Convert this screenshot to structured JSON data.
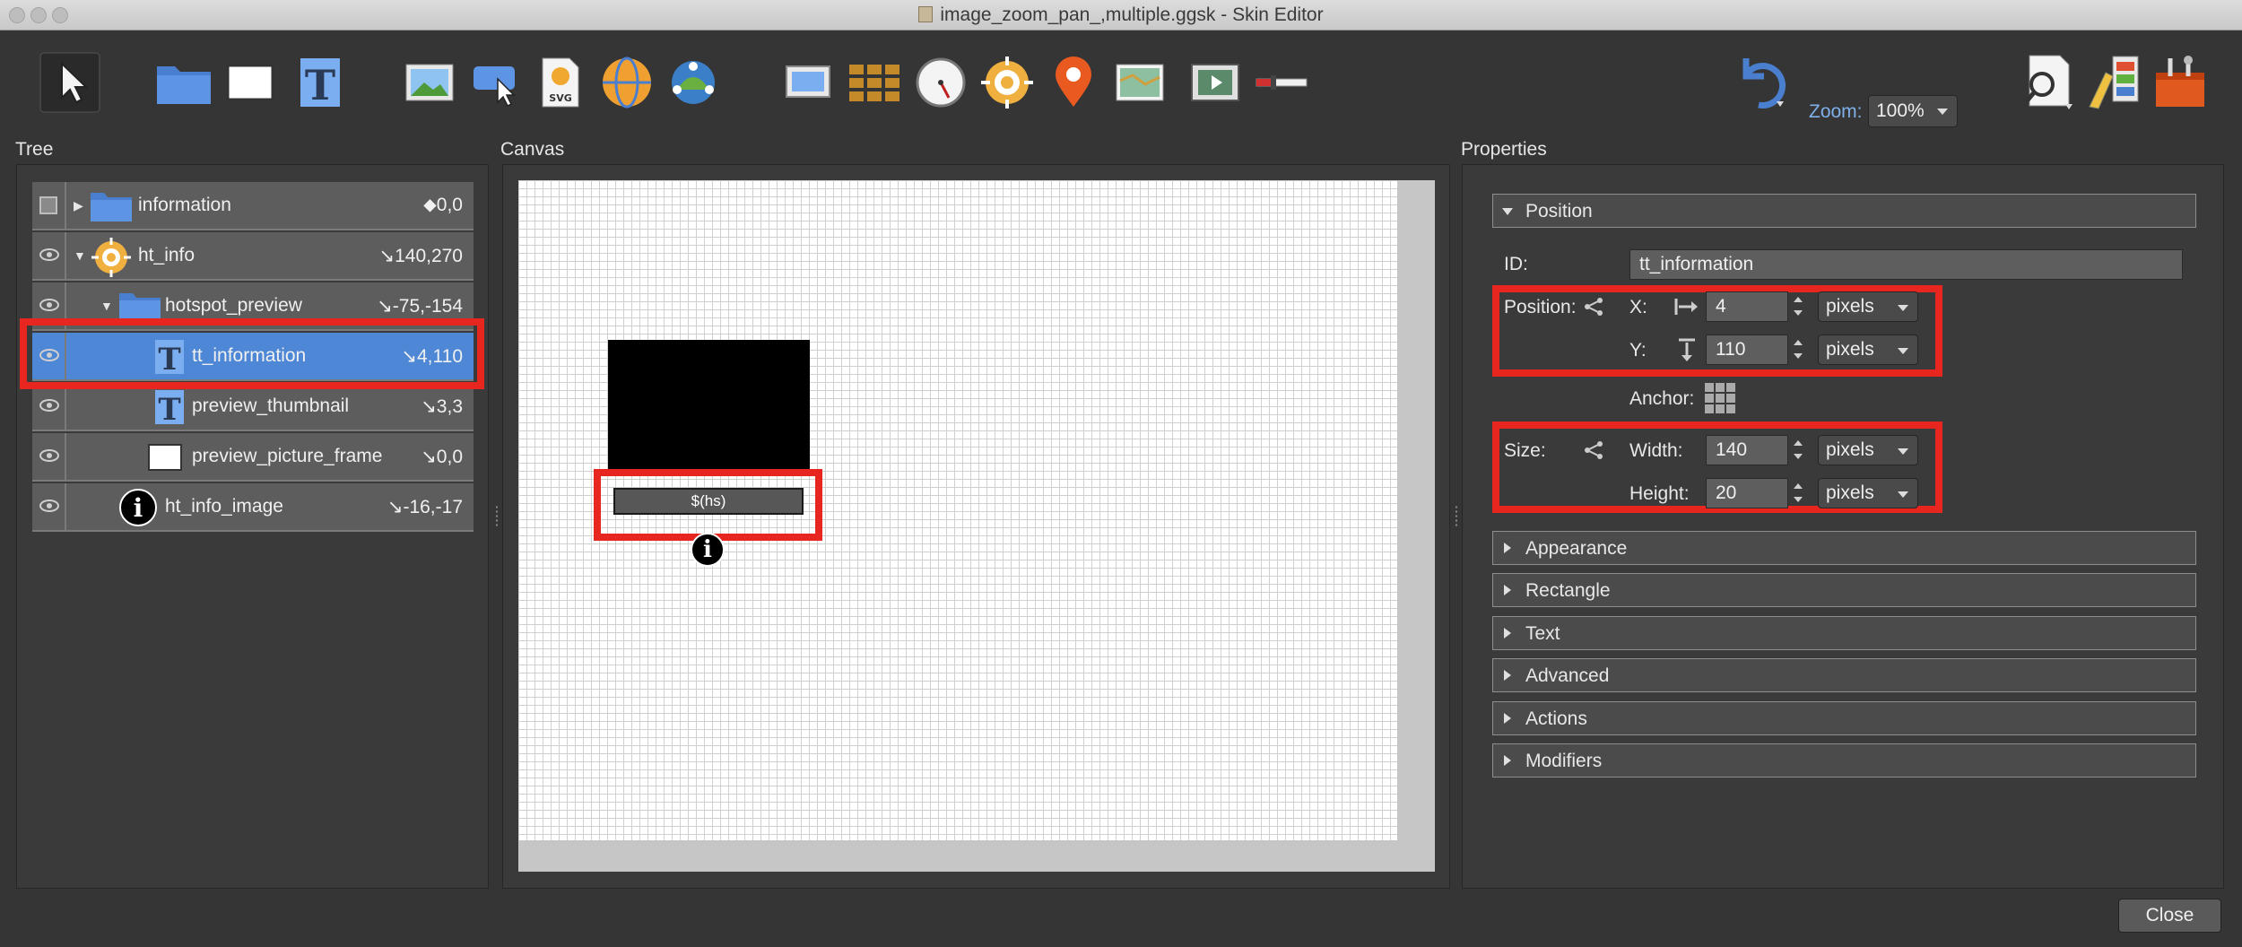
{
  "window": {
    "title": "image_zoom_pan_,multiple.ggsk - Skin Editor"
  },
  "toolbar": {
    "icons": [
      "select-pointer-icon",
      "folder-container-icon",
      "rectangle-icon",
      "text-icon",
      "image-icon",
      "button-icon",
      "svg-icon",
      "panorama-icon",
      "cloner-icon",
      "screen-icon",
      "grid-icon",
      "gauge-icon",
      "hotspot-target-icon",
      "map-pin-icon",
      "map-icon",
      "video-icon",
      "slider-icon",
      "undo-icon",
      "zoom-inspect-icon",
      "theme-icon",
      "toolbox-icon"
    ],
    "zoom_label": "Zoom:",
    "zoom_value": "100%"
  },
  "panels": {
    "tree": "Tree",
    "canvas": "Canvas",
    "properties": "Properties"
  },
  "tree": {
    "rows": [
      {
        "name": "information",
        "value": "⬥0,0",
        "visible": false,
        "expanded": false,
        "icon": "folder-icon"
      },
      {
        "name": "ht_info",
        "value": "↘140,270",
        "visible": true,
        "expanded": true,
        "icon": "hotspot-icon"
      },
      {
        "name": "hotspot_preview",
        "value": "↘-75,-154",
        "visible": true,
        "expanded": true,
        "icon": "folder-icon"
      },
      {
        "name": "tt_information",
        "value": "↘4,110",
        "visible": true,
        "selected": true,
        "icon": "text-icon"
      },
      {
        "name": "preview_thumbnail",
        "value": "↘3,3",
        "visible": true,
        "icon": "text-icon"
      },
      {
        "name": "preview_picture_frame",
        "value": "↘0,0",
        "visible": true,
        "icon": "rectangle-icon"
      },
      {
        "name": "ht_info_image",
        "value": "↘-16,-17",
        "visible": true,
        "icon": "info-icon"
      }
    ]
  },
  "canvas": {
    "hs_text": "$(hs)",
    "info_glyph": "i"
  },
  "properties": {
    "position_section": "Position",
    "id_label": "ID:",
    "id_value": "tt_information",
    "position_label": "Position:",
    "x_label": "X:",
    "x_value": "4",
    "x_unit": "pixels",
    "y_label": "Y:",
    "y_value": "110",
    "y_unit": "pixels",
    "anchor_label": "Anchor:",
    "size_label": "Size:",
    "width_label": "Width:",
    "width_value": "140",
    "width_unit": "pixels",
    "height_label": "Height:",
    "height_value": "20",
    "height_unit": "pixels",
    "sections": [
      "Appearance",
      "Rectangle",
      "Text",
      "Advanced",
      "Actions",
      "Modifiers"
    ]
  },
  "footer": {
    "close_label": "Close"
  },
  "colors": {
    "selection": "#4d87d6",
    "highlight": "#e6261f",
    "accent": "#7fb0ea"
  }
}
